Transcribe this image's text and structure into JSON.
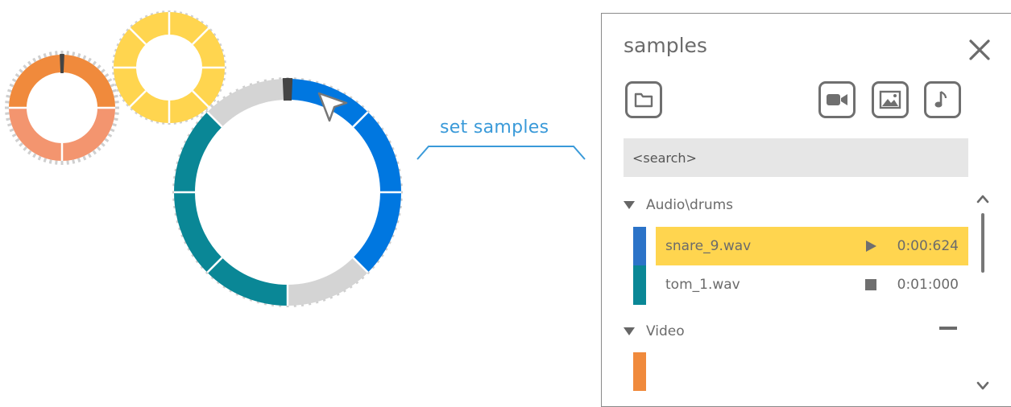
{
  "callout": {
    "label": "set samples"
  },
  "panel": {
    "title": "samples",
    "search": {
      "placeholder": "<search>",
      "value": ""
    },
    "folders": [
      {
        "label": "Audio\\drums",
        "files": [
          {
            "name": "snare_9.wav",
            "time": "0:00:624",
            "state": "play",
            "highlighted": true,
            "color": "#2b73c8"
          },
          {
            "name": "tom_1.wav",
            "time": "0:01:000",
            "state": "stop",
            "highlighted": false,
            "color": "#0a8796"
          }
        ]
      },
      {
        "label": "Video",
        "files": [],
        "color": "#f08a3c"
      }
    ]
  },
  "wheels": {
    "small_orange": {
      "colors": [
        "#f08a3c",
        "#f3956f"
      ]
    },
    "small_yellow": {
      "colors": [
        "#ffd54f"
      ]
    },
    "big": {
      "colors": [
        "#0077e0",
        "#0a8796",
        "#d4d4d4"
      ]
    }
  },
  "colors": {
    "highlight": "#ffd54f",
    "accent": "#3a9ad9",
    "tick": "#cfcfcf",
    "playhead": "#444444"
  },
  "icons": [
    "close-icon",
    "folder-icon",
    "video-icon",
    "image-icon",
    "music-icon",
    "play-icon",
    "stop-icon",
    "chevron-up-icon",
    "chevron-down-icon",
    "minus-icon",
    "triangle-down-icon",
    "cursor-icon"
  ]
}
